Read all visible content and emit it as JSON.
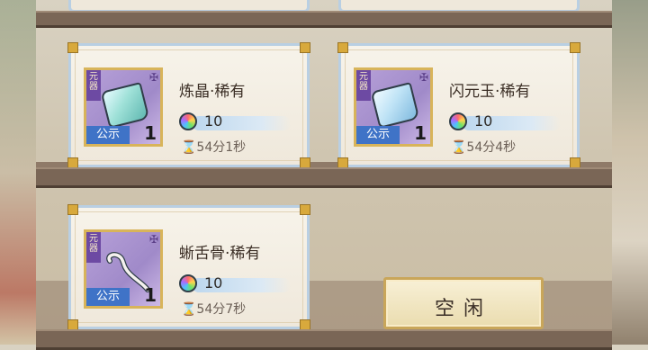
{
  "items": [
    {
      "name": "炼晶·稀有",
      "tag_vertical": "元\n器",
      "tag_public": "公示",
      "quantity": "1",
      "price": "10",
      "timer": "⌛54分1秒",
      "gem_style": "green"
    },
    {
      "name": "闪元玉·稀有",
      "tag_vertical": "元\n器",
      "tag_public": "公示",
      "quantity": "1",
      "price": "10",
      "timer": "⌛54分4秒",
      "gem_style": "blue"
    },
    {
      "name": "蜥舌骨·稀有",
      "tag_vertical": "元\n器",
      "tag_public": "公示",
      "quantity": "1",
      "price": "10",
      "timer": "⌛54分7秒",
      "gem_style": "bone"
    }
  ],
  "idle_slot": {
    "label": "空闲"
  },
  "colors": {
    "accent_frame": "#d8b45a",
    "card_border": "#b9cfe3",
    "public_tag": "#3f73c7",
    "shelf": "#7a6656"
  }
}
